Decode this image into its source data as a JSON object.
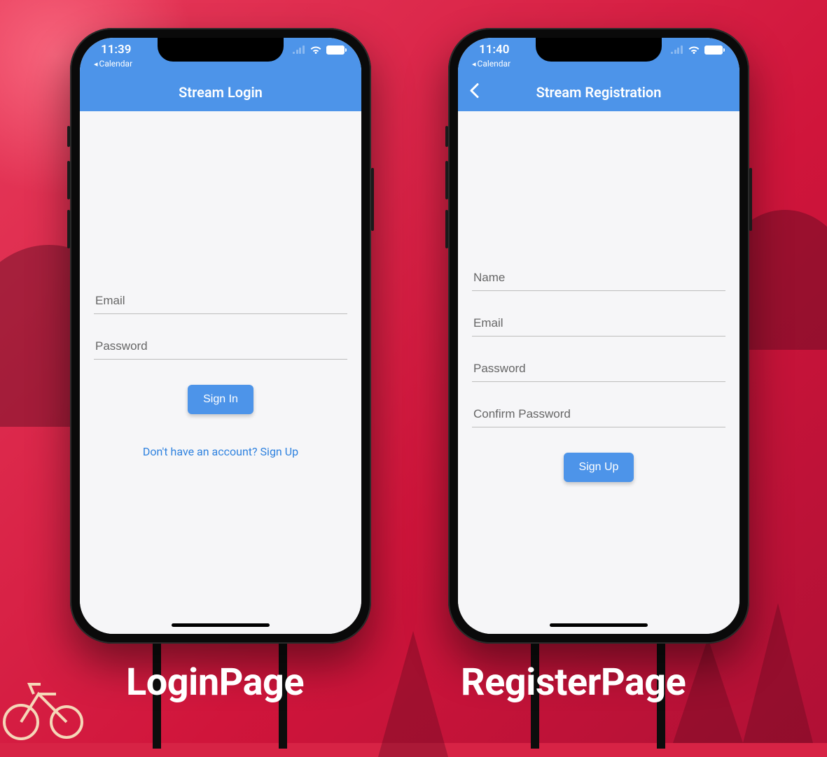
{
  "colors": {
    "accent": "#4d94e9",
    "background_red": "#d72345"
  },
  "captions": {
    "login": "LoginPage",
    "register": "RegisterPage"
  },
  "login": {
    "statusbar": {
      "time": "11:39",
      "back_app": "Calendar"
    },
    "appbar_title": "Stream Login",
    "fields": {
      "email_placeholder": "Email",
      "password_placeholder": "Password"
    },
    "signin_button": "Sign In",
    "signup_link": "Don't have an account? Sign Up"
  },
  "register": {
    "statusbar": {
      "time": "11:40",
      "back_app": "Calendar"
    },
    "appbar_title": "Stream Registration",
    "fields": {
      "name_placeholder": "Name",
      "email_placeholder": "Email",
      "password_placeholder": "Password",
      "confirm_placeholder": "Confirm Password"
    },
    "signup_button": "Sign Up"
  }
}
